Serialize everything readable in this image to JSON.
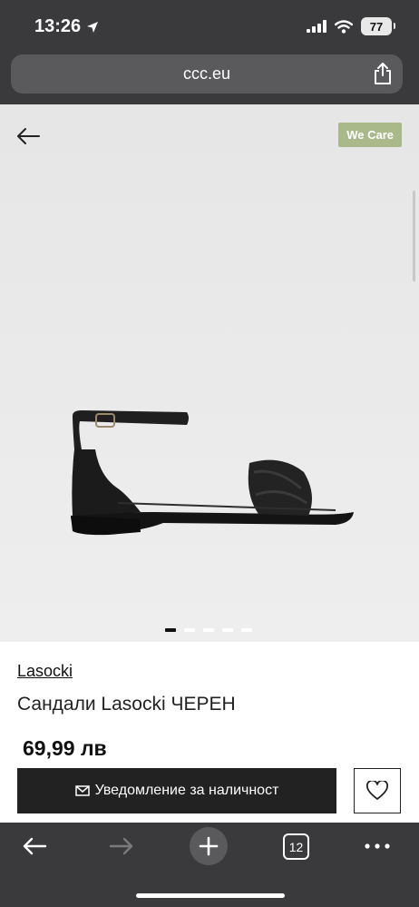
{
  "status_bar": {
    "time": "13:26",
    "battery": "77"
  },
  "browser": {
    "url": "ccc.eu",
    "tab_count": "12"
  },
  "product": {
    "badge": "We Care",
    "brand": "Lasocki",
    "title": "Сандали Lasocki ЧЕРЕН",
    "price": "69,99 лв",
    "notify_label": "Уведомление за наличност",
    "gallery_dots": 5,
    "active_dot": 1
  },
  "icons": [
    "location-arrow-icon",
    "signal-icon",
    "wifi-icon",
    "share-icon",
    "back-arrow-icon",
    "mail-icon",
    "heart-icon",
    "forward-arrow-icon",
    "plus-icon",
    "more-icon"
  ],
  "colors": {
    "chrome": "#3a3a3c",
    "badge": "#a9b98a",
    "button": "#222222"
  }
}
